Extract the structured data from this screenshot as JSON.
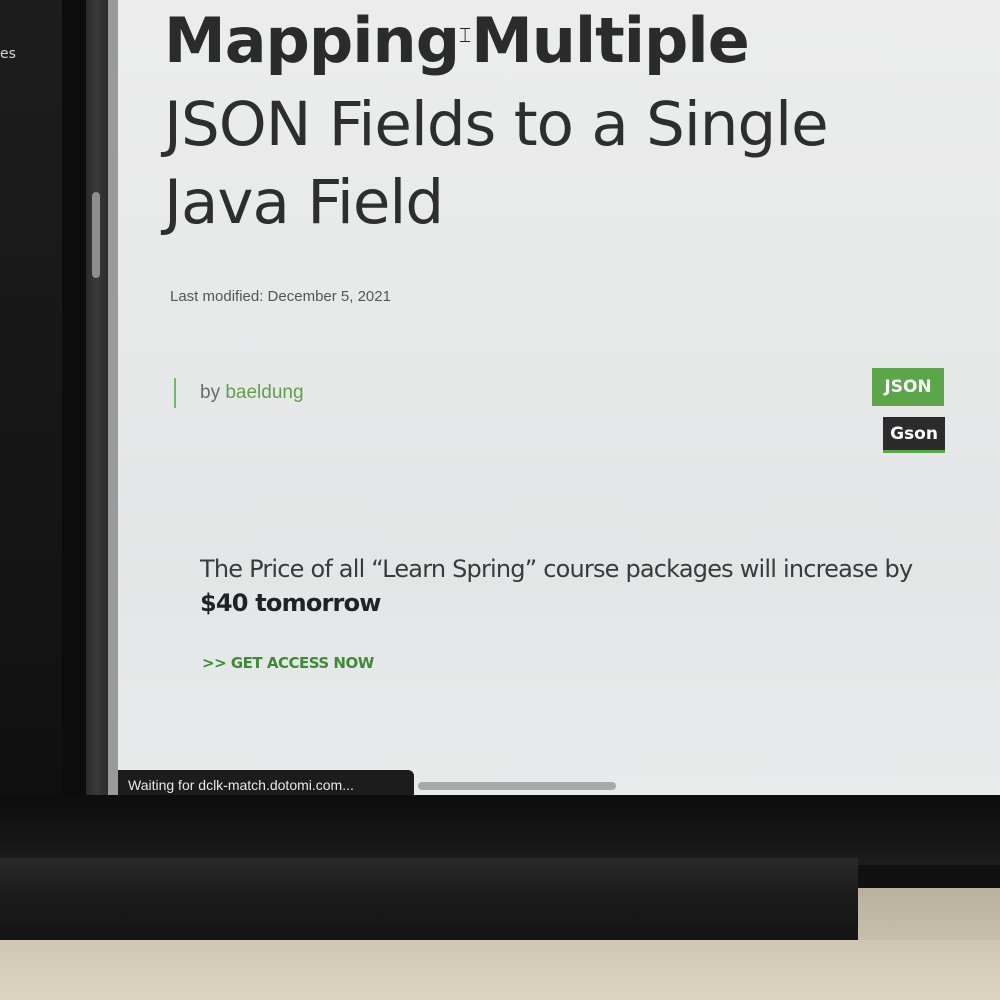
{
  "sidebar": {
    "partial_text": "es"
  },
  "article": {
    "title_bold": "Mapping",
    "title_bold_2": "Multiple",
    "title_rest": "JSON Fields to a Single Java Field",
    "last_modified": "Last modified: December 5, 2021",
    "author_prefix": "by",
    "author_name": "baeldung",
    "tags": [
      {
        "label": "JSON",
        "color": "#5aa648"
      },
      {
        "label": "Gson",
        "color": "#2b2b2b"
      }
    ]
  },
  "promo": {
    "text": "The Price of all “Learn Spring” course packages will increase by",
    "highlight": "$40 tomorrow",
    "cta": ">> GET ACCESS NOW",
    "cta_color": "#3f8a35"
  },
  "status_bar": {
    "text": "Waiting for dclk-match.dotomi.com..."
  }
}
